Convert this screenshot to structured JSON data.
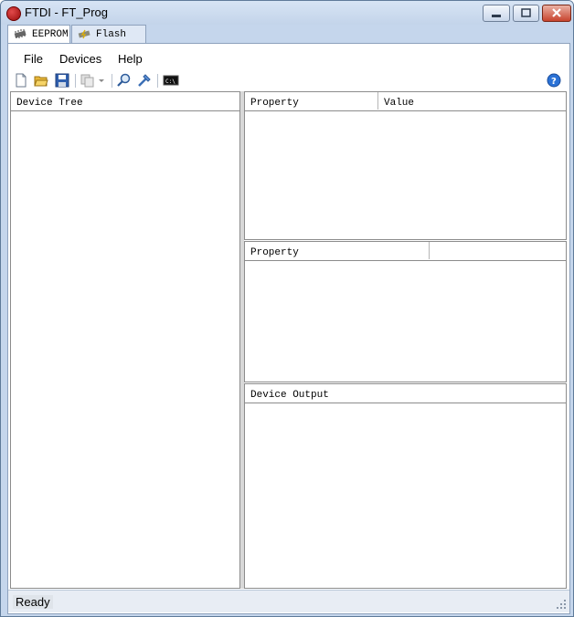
{
  "window": {
    "title": "FTDI - FT_Prog"
  },
  "window_controls": {
    "minimize": "▭",
    "maximize": "□",
    "close": "✕"
  },
  "tabs": [
    {
      "label": "EEPROM",
      "icon": "chip-icon"
    },
    {
      "label": "Flash ROM",
      "icon": "flash-chip-icon"
    }
  ],
  "menu": {
    "items": [
      "File",
      "Devices",
      "Help"
    ]
  },
  "toolbar": {
    "icons": [
      "new-file-icon",
      "open-folder-icon",
      "save-icon",
      "copy-icon",
      "dropdown-arrow-icon",
      "search-icon",
      "program-icon",
      "cmd-prompt-icon",
      "help-icon"
    ]
  },
  "panels": {
    "device_tree": {
      "header": "Device Tree"
    },
    "property_value": {
      "property_header": "Property",
      "value_header": "Value"
    },
    "property_detail": {
      "property_header": "Property"
    },
    "device_output": {
      "header": "Device Output"
    }
  },
  "status": {
    "text": "Ready"
  }
}
